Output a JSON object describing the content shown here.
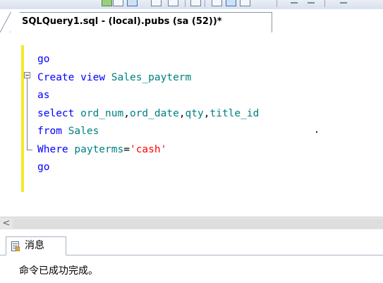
{
  "document_tab": {
    "title": "SQLQuery1.sql - (local).pubs (sa (52))*"
  },
  "editor": {
    "lines": [
      [
        {
          "t": "go",
          "c": "kw"
        }
      ],
      [
        {
          "t": "Create",
          "c": "kw"
        },
        {
          "t": " ",
          "c": "plain"
        },
        {
          "t": "view",
          "c": "kw"
        },
        {
          "t": " ",
          "c": "plain"
        },
        {
          "t": "Sales_payterm",
          "c": "id"
        }
      ],
      [
        {
          "t": "as",
          "c": "kw"
        }
      ],
      [
        {
          "t": "select",
          "c": "kw"
        },
        {
          "t": " ",
          "c": "plain"
        },
        {
          "t": "ord_num",
          "c": "id"
        },
        {
          "t": ",",
          "c": "plain"
        },
        {
          "t": "ord_date",
          "c": "id"
        },
        {
          "t": ",",
          "c": "plain"
        },
        {
          "t": "qty",
          "c": "id"
        },
        {
          "t": ",",
          "c": "plain"
        },
        {
          "t": "title_id",
          "c": "id"
        }
      ],
      [
        {
          "t": "from",
          "c": "kw"
        },
        {
          "t": " ",
          "c": "plain"
        },
        {
          "t": "Sales",
          "c": "id"
        }
      ],
      [
        {
          "t": "Where",
          "c": "kw"
        },
        {
          "t": " ",
          "c": "plain"
        },
        {
          "t": "payterms",
          "c": "id"
        },
        {
          "t": "=",
          "c": "plain"
        },
        {
          "t": "'cash'",
          "c": "str"
        }
      ],
      [
        {
          "t": "go",
          "c": "kw"
        }
      ]
    ]
  },
  "scrollbar": {
    "left_arrow": "<"
  },
  "results": {
    "tab_label": "消息",
    "message": "命令已成功完成。"
  },
  "colors": {
    "keyword": "#0000ff",
    "identifier": "#008080",
    "string": "#ff0000",
    "changed_line_marker": "#f2ea2a"
  },
  "icons": {
    "results_tab": "messages-icon",
    "fold": "collapse-icon"
  }
}
